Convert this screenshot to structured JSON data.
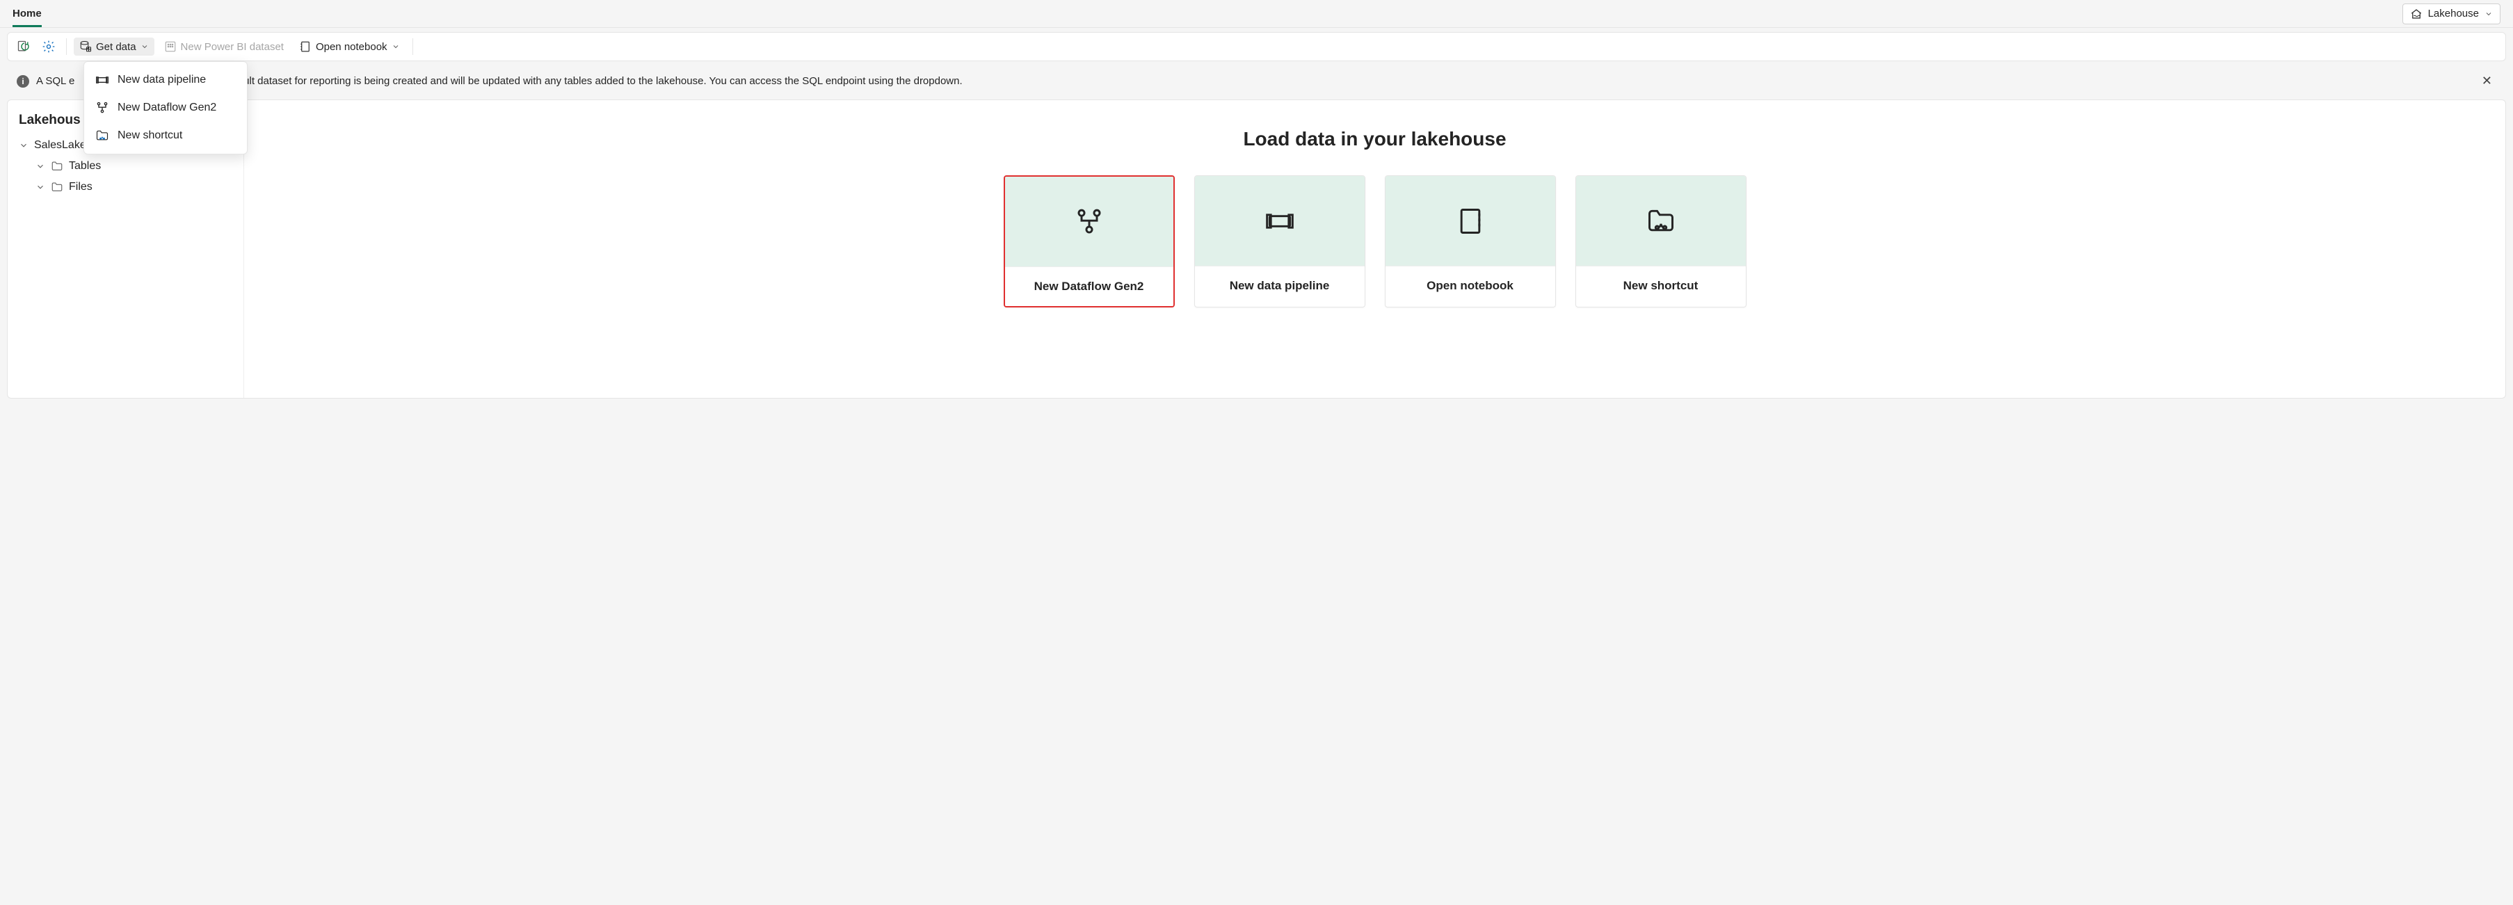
{
  "topbar": {
    "home_label": "Home",
    "mode_label": "Lakehouse"
  },
  "toolbar": {
    "get_data_label": "Get data",
    "new_pb_dataset_label": "New Power BI dataset",
    "open_notebook_label": "Open notebook"
  },
  "dropdown": {
    "items": [
      {
        "label": "New data pipeline"
      },
      {
        "label": "New Dataflow Gen2"
      },
      {
        "label": "New shortcut"
      }
    ]
  },
  "info": {
    "prefix": "A SQL e",
    "text": "efault dataset for reporting is being created and will be updated with any tables added to the lakehouse. You can access the SQL endpoint using the dropdown."
  },
  "sidebar": {
    "title_visible": "Lakehous",
    "root_label": "SalesLakehouse",
    "tables_label": "Tables",
    "files_label": "Files"
  },
  "main": {
    "title": "Load data in your lakehouse",
    "cards": [
      {
        "label": "New Dataflow Gen2"
      },
      {
        "label": "New data pipeline"
      },
      {
        "label": "Open notebook"
      },
      {
        "label": "New shortcut"
      }
    ]
  }
}
